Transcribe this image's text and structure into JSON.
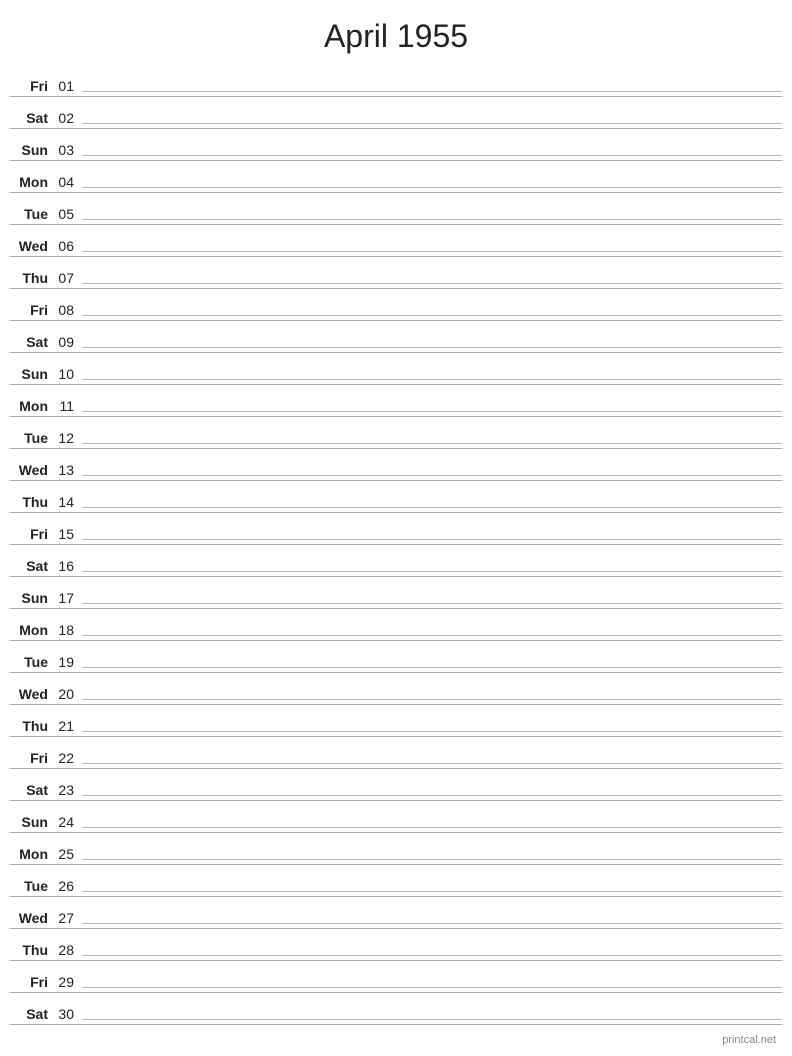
{
  "title": "April 1955",
  "footer": "printcal.net",
  "days": [
    {
      "name": "Fri",
      "num": "01"
    },
    {
      "name": "Sat",
      "num": "02"
    },
    {
      "name": "Sun",
      "num": "03"
    },
    {
      "name": "Mon",
      "num": "04"
    },
    {
      "name": "Tue",
      "num": "05"
    },
    {
      "name": "Wed",
      "num": "06"
    },
    {
      "name": "Thu",
      "num": "07"
    },
    {
      "name": "Fri",
      "num": "08"
    },
    {
      "name": "Sat",
      "num": "09"
    },
    {
      "name": "Sun",
      "num": "10"
    },
    {
      "name": "Mon",
      "num": "11"
    },
    {
      "name": "Tue",
      "num": "12"
    },
    {
      "name": "Wed",
      "num": "13"
    },
    {
      "name": "Thu",
      "num": "14"
    },
    {
      "name": "Fri",
      "num": "15"
    },
    {
      "name": "Sat",
      "num": "16"
    },
    {
      "name": "Sun",
      "num": "17"
    },
    {
      "name": "Mon",
      "num": "18"
    },
    {
      "name": "Tue",
      "num": "19"
    },
    {
      "name": "Wed",
      "num": "20"
    },
    {
      "name": "Thu",
      "num": "21"
    },
    {
      "name": "Fri",
      "num": "22"
    },
    {
      "name": "Sat",
      "num": "23"
    },
    {
      "name": "Sun",
      "num": "24"
    },
    {
      "name": "Mon",
      "num": "25"
    },
    {
      "name": "Tue",
      "num": "26"
    },
    {
      "name": "Wed",
      "num": "27"
    },
    {
      "name": "Thu",
      "num": "28"
    },
    {
      "name": "Fri",
      "num": "29"
    },
    {
      "name": "Sat",
      "num": "30"
    }
  ]
}
